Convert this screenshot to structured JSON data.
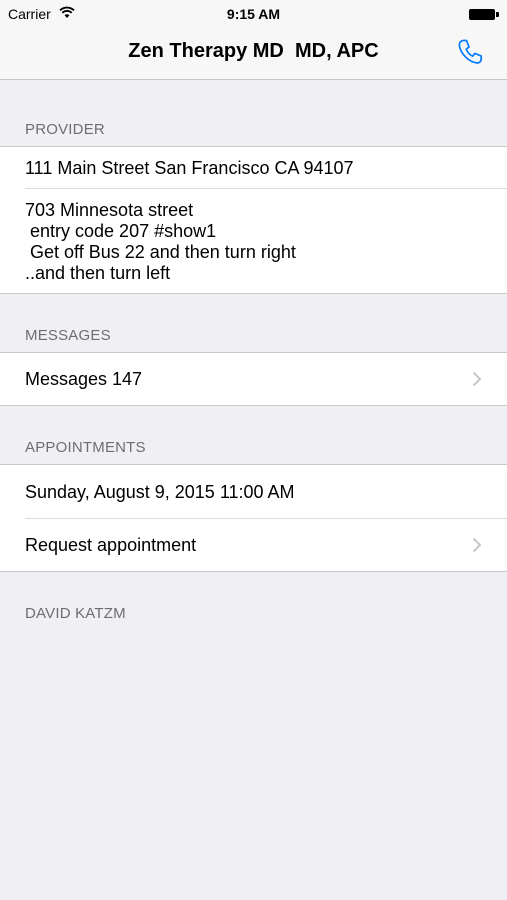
{
  "status_bar": {
    "carrier": "Carrier",
    "time": "9:15 AM"
  },
  "nav": {
    "title": "Zen Therapy MD  MD, APC",
    "phone_icon": "phone-icon",
    "accent_color": "#007aff"
  },
  "provider": {
    "header": "PROVIDER",
    "address": "111 Main Street San Francisco CA 94107",
    "directions": "703 Minnesota street\n entry code 207 #show1\n Get off Bus 22 and then turn right\n..and then turn left"
  },
  "messages": {
    "header": "MESSAGES",
    "label": "Messages 147"
  },
  "appointments": {
    "header": "APPOINTMENTS",
    "items": [
      {
        "label": "Sunday, August 9, 2015 11:00 AM"
      },
      {
        "label": "Request appointment"
      }
    ]
  },
  "footer_section": {
    "header": "DAVID KATZM"
  }
}
